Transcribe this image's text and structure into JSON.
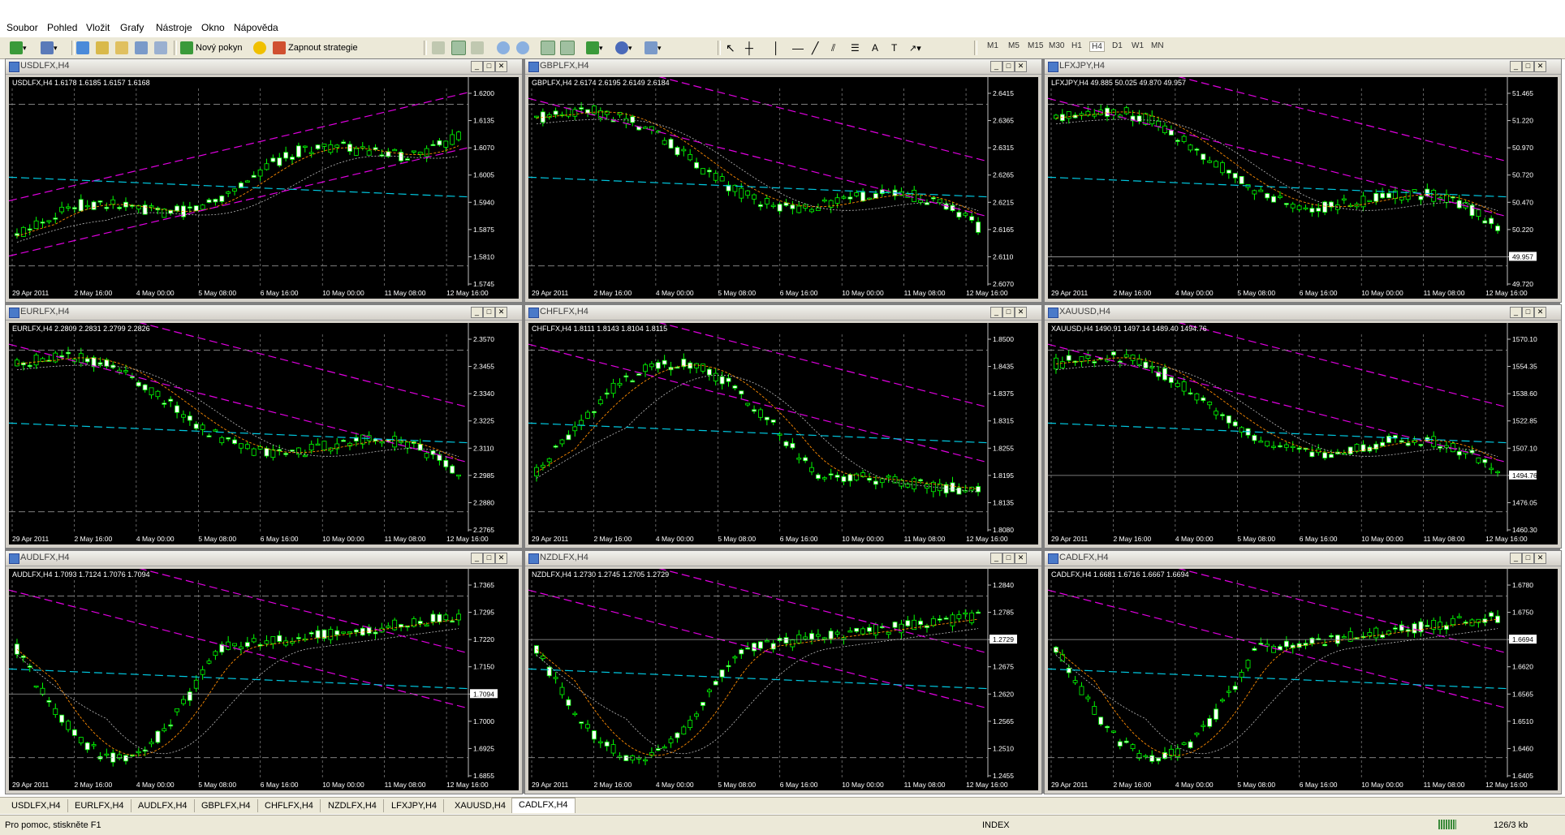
{
  "menu": [
    "Soubor",
    "Pohled",
    "Vložit",
    "Grafy",
    "Nástroje",
    "Okno",
    "Nápověda"
  ],
  "toolbar": {
    "new_order_label": "Nový pokyn",
    "strategy_label": "Zapnout strategie",
    "timeframes": [
      "M1",
      "M5",
      "M15",
      "M30",
      "H1",
      "H4",
      "D1",
      "W1",
      "MN"
    ],
    "active_timeframe": "H4"
  },
  "charts": [
    {
      "title": "USDLFX,H4",
      "ohlc": "USDLFX,H4  1.6178 1.6185 1.6157 1.6168",
      "prices": [
        "1.6200",
        "1.6135",
        "1.6070",
        "1.6005",
        "1.5940",
        "1.5875",
        "1.5810",
        "1.5745"
      ],
      "current": "1.6168",
      "trend": "up"
    },
    {
      "title": "GBPLFX,H4",
      "ohlc": "GBPLFX,H4  2.6174 2.6195 2.6149 2.6184",
      "prices": [
        "2.6415",
        "2.6365",
        "2.6315",
        "2.6265",
        "2.6215",
        "2.6165",
        "2.6110",
        "2.6070"
      ],
      "current": "2.6184",
      "trend": "down"
    },
    {
      "title": "LFXJPY,H4",
      "ohlc": "LFXJPY,H4  49.885 50.025 49.870 49.957",
      "prices": [
        "51.465",
        "51.220",
        "50.970",
        "50.720",
        "50.470",
        "50.220",
        "49.957",
        "49.720"
      ],
      "current": "49.957",
      "trend": "down"
    },
    {
      "title": "EURLFX,H4",
      "ohlc": "EURLFX,H4  2.2809 2.2831 2.2799 2.2826",
      "prices": [
        "2.3570",
        "2.3455",
        "2.3340",
        "2.3225",
        "2.3110",
        "2.2985",
        "2.2880",
        "2.2765"
      ],
      "current": "2.2826",
      "trend": "down"
    },
    {
      "title": "CHFLFX,H4",
      "ohlc": "CHFLFX,H4  1.8111 1.8143 1.8104 1.8115",
      "prices": [
        "1.8500",
        "1.8435",
        "1.8375",
        "1.8315",
        "1.8255",
        "1.8195",
        "1.8135",
        "1.8080"
      ],
      "current": "1.8115",
      "trend": "peak"
    },
    {
      "title": "XAUUSD,H4",
      "ohlc": "XAUUSD,H4  1490.91 1497.14 1489.40 1494.76",
      "prices": [
        "1570.10",
        "1554.35",
        "1538.60",
        "1522.85",
        "1507.10",
        "1494.76",
        "1476.05",
        "1460.30"
      ],
      "current": "1494.76",
      "trend": "down"
    },
    {
      "title": "AUDLFX,H4",
      "ohlc": "AUDLFX,H4  1.7093 1.7124 1.7076 1.7094",
      "prices": [
        "1.7365",
        "1.7295",
        "1.7220",
        "1.7150",
        "1.7094",
        "1.7000",
        "1.6925",
        "1.6855"
      ],
      "current": "1.7094",
      "trend": "valley"
    },
    {
      "title": "NZDLFX,H4",
      "ohlc": "NZDLFX,H4  1.2730 1.2745 1.2705 1.2729",
      "prices": [
        "1.2840",
        "1.2785",
        "1.2729",
        "1.2675",
        "1.2620",
        "1.2565",
        "1.2510",
        "1.2455"
      ],
      "current": "1.2729",
      "trend": "valley"
    },
    {
      "title": "CADLFX,H4",
      "ohlc": "CADLFX,H4  1.6681 1.6716 1.6667 1.6694",
      "prices": [
        "1.6780",
        "1.6750",
        "1.6694",
        "1.6620",
        "1.6565",
        "1.6510",
        "1.6460",
        "1.6405"
      ],
      "current": "1.6694",
      "trend": "valley"
    }
  ],
  "time_labels": [
    "29 Apr 2011",
    "2 May 16:00",
    "4 May 00:00",
    "5 May 08:00",
    "6 May 16:00",
    "10 May 00:00",
    "11 May 08:00",
    "12 May 16:00"
  ],
  "tabs": [
    "USDLFX,H4",
    "EURLFX,H4",
    "AUDLFX,H4",
    "GBPLFX,H4",
    "CHFLFX,H4",
    "NZDLFX,H4",
    "LFXJPY,H4",
    "XAUUSD,H4",
    "CADLFX,H4"
  ],
  "active_tab": "CADLFX,H4",
  "status": {
    "help": "Pro pomoc, stiskněte F1",
    "profile": "INDEX",
    "traffic": "126/3 kb"
  },
  "colors": {
    "bull": "#00ff00",
    "bear": "#00ff00",
    "bg": "#000000",
    "grid": "#c0c0c0",
    "channel_cyan": "#00c8e0",
    "channel_magenta": "#e000e0",
    "ma_orange": "#ff8c00",
    "ma_gray": "#c0c0c0"
  }
}
